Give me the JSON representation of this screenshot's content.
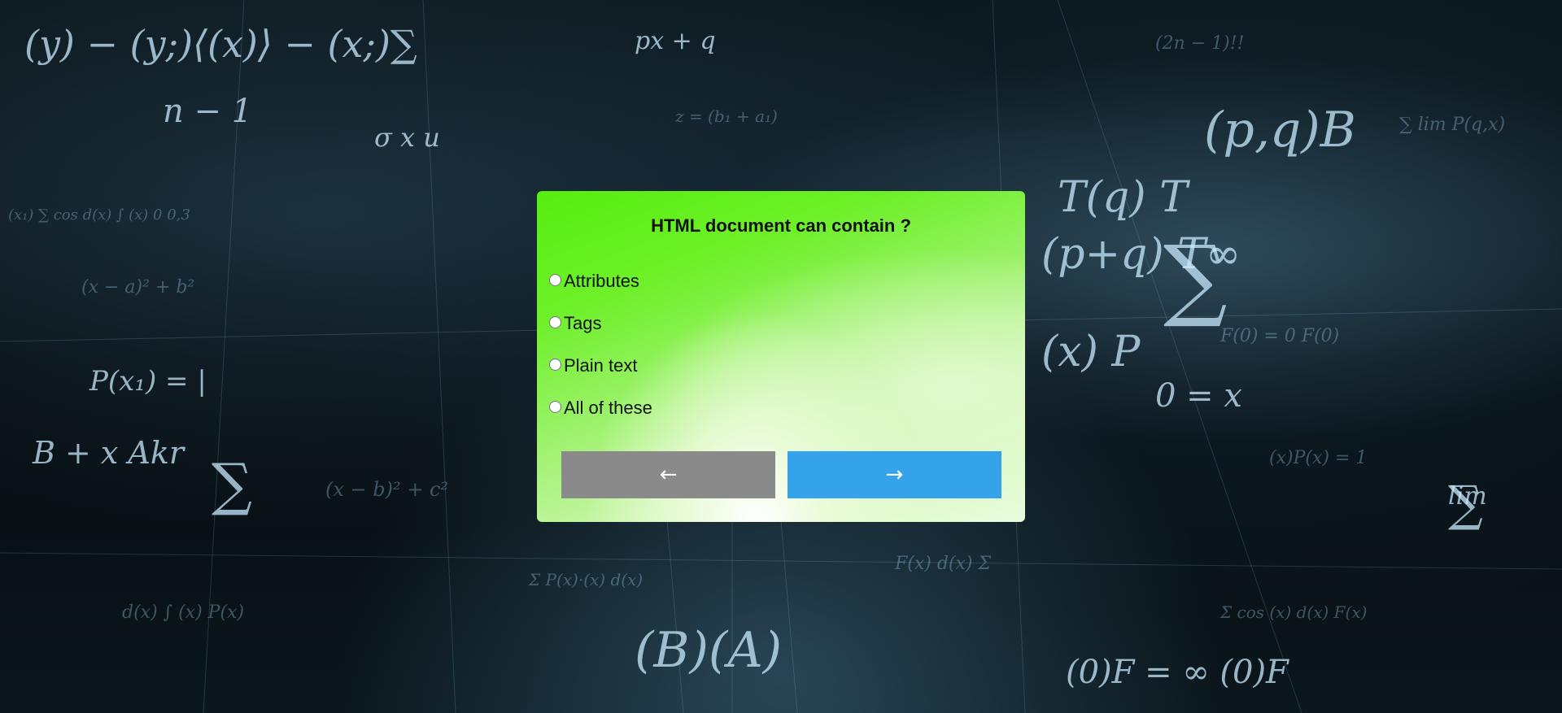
{
  "quiz": {
    "question": "HTML document can contain ?",
    "options": [
      {
        "label": "Attributes",
        "selected": false
      },
      {
        "label": "Tags",
        "selected": false
      },
      {
        "label": "Plain text",
        "selected": false
      },
      {
        "label": "All of these",
        "selected": false
      }
    ],
    "prev_icon": "←",
    "next_icon": "→",
    "icons": {
      "prev": "arrow-left-icon",
      "next": "arrow-right-icon"
    },
    "colors": {
      "card_top": "#57ee10",
      "card_bottom": "#eafcdf",
      "prev_button": "#8a8a8a",
      "next_button": "#35a3ea"
    }
  }
}
